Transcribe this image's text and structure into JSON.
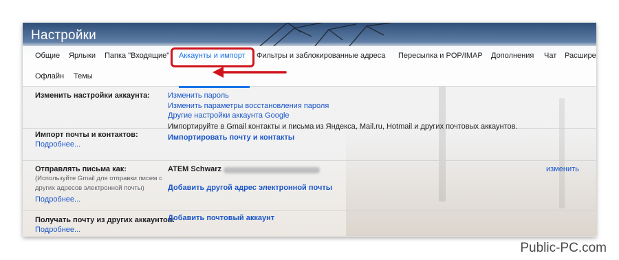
{
  "header": {
    "title": "Настройки"
  },
  "tabs_row1": [
    {
      "label": "Общие"
    },
    {
      "label": "Ярлыки"
    },
    {
      "label": "Папка \"Входящие\""
    },
    {
      "label": "Аккаунты и импорт",
      "active": true
    },
    {
      "label": "Фильтры и заблокированные адреса"
    },
    {
      "label": "Пересылка и POP/IMAP"
    },
    {
      "label": "Дополнения"
    },
    {
      "label": "Чат"
    },
    {
      "label": "Расшире"
    }
  ],
  "tabs_row2": [
    {
      "label": "Офлайн"
    },
    {
      "label": "Темы"
    }
  ],
  "sections": {
    "account": {
      "label": "Изменить настройки аккаунта:",
      "links": [
        "Изменить пароль",
        "Изменить параметры восстановления пароля",
        "Другие настройки аккаунта Google"
      ]
    },
    "import": {
      "label": "Импорт почты и контактов:",
      "more": "Подробнее...",
      "description": "Импортируйте в Gmail контакты и письма из Яндекса, Mail.ru, Hotmail и других почтовых аккаунтов.",
      "action": "Импортировать почту и контакты"
    },
    "send_as": {
      "label": "Отправлять письма как:",
      "note": "(Используйте Gmail для отправки писем с других адресов электронной почты)",
      "more": "Подробнее...",
      "name": "ATEM Schwarz",
      "change": "изменить",
      "action": "Добавить другой адрес электронной почты"
    },
    "check_mail": {
      "label": "Получать почту из других аккаунтов:",
      "more": "Подробнее...",
      "action": "Добавить почтовый аккаунт"
    }
  },
  "colors": {
    "link": "#1a56c9",
    "highlight": "#d0131a",
    "active_tab": "#1a73e8"
  },
  "watermark": "Public-PC.com"
}
